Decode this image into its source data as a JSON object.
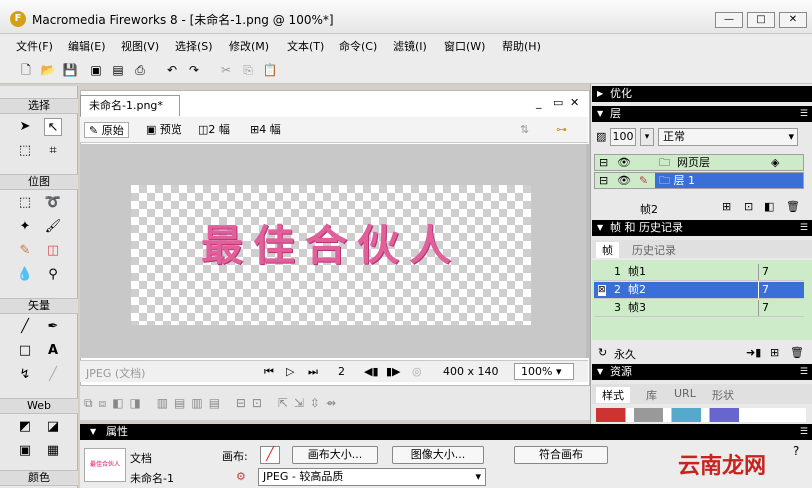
{
  "window": {
    "title": "Macromedia Fireworks 8 - [未命名-1.png @ 100%*]",
    "min": "—",
    "max": "□",
    "close": "✕"
  },
  "menu": [
    "文件(F)",
    "编辑(E)",
    "视图(V)",
    "选择(S)",
    "修改(M)",
    "文本(T)",
    "命令(C)",
    "滤镜(I)",
    "窗口(W)",
    "帮助(H)"
  ],
  "tools": {
    "select_label": "选择",
    "bitmap_label": "位图",
    "vector_label": "矢量",
    "web_label": "Web",
    "color_label": "颜色"
  },
  "doc": {
    "tab": "未命名-1.png*",
    "minimize": "_",
    "restore": "▭",
    "close": "✕",
    "views": {
      "original": "原始",
      "preview": "预览",
      "two_up": "2 幅",
      "four_up": "4 幅"
    },
    "canvas_text": "最佳合伙人",
    "status": {
      "format": "JPEG (文档)",
      "frame": "2",
      "size": "400 x 140",
      "zoom": "100%"
    }
  },
  "panels": {
    "optimize": "优化",
    "layers": {
      "title": "层",
      "opacity": "100",
      "blend": "正常",
      "rows": [
        {
          "name": "网页层"
        },
        {
          "name": "层 1"
        }
      ],
      "current_frame": "帧2"
    },
    "frames": {
      "title": "帧 和 历史记录",
      "tabs": [
        "帧",
        "历史记录"
      ],
      "rows": [
        {
          "num": "1",
          "name": "帧1",
          "delay": "7"
        },
        {
          "num": "2",
          "name": "帧2",
          "delay": "7"
        },
        {
          "num": "3",
          "name": "帧3",
          "delay": "7"
        }
      ],
      "loop": "永久"
    },
    "assets": {
      "title": "资源",
      "tabs": [
        "样式",
        "库",
        "URL",
        "形状"
      ]
    }
  },
  "properties": {
    "title": "属性",
    "doc_label": "文档",
    "doc_name": "未命名-1",
    "canvas_label": "画布:",
    "canvas_size_btn": "画布大小...",
    "image_size_btn": "图像大小...",
    "fit_canvas_btn": "符合画布",
    "export_format": "JPEG - 较高品质"
  },
  "watermark": "云南龙网",
  "colors": {
    "accent": "#3a6fd8",
    "canvas_text": "#e0609a",
    "panel_header": "#000000",
    "layer_green": "#cdebc8"
  }
}
